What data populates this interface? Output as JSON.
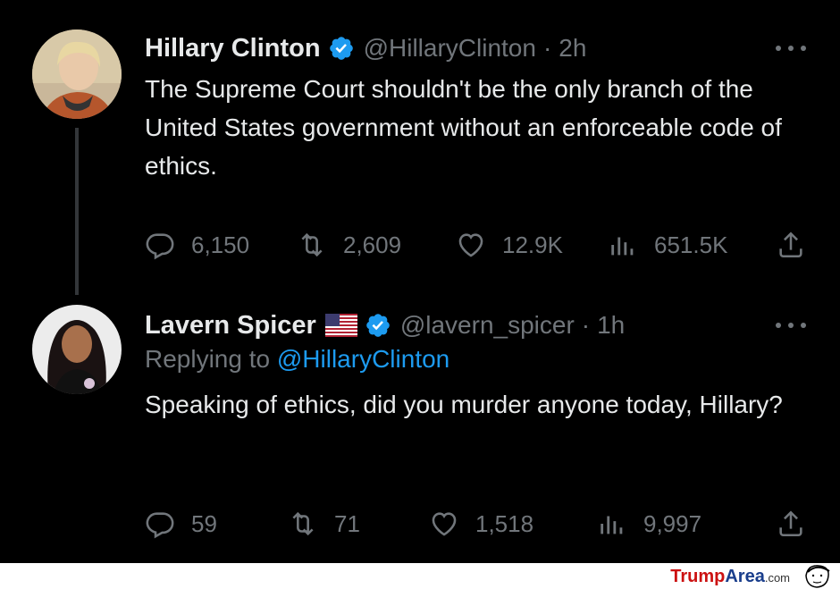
{
  "tweets": [
    {
      "name": "Hillary Clinton",
      "handle": "@HillaryClinton",
      "separator": "·",
      "time": "2h",
      "text": "The Supreme Court shouldn't be the only branch of the United States government without an enforceable code of ethics.",
      "replies": "6,150",
      "retweets": "2,609",
      "likes": "12.9K",
      "views": "651.5K"
    },
    {
      "name": "Lavern Spicer",
      "handle": "@lavern_spicer",
      "separator": "·",
      "time": "1h",
      "replying_label": "Replying to",
      "replying_to": "@HillaryClinton",
      "text": "Speaking of ethics, did you murder anyone today, Hillary?",
      "replies": "59",
      "retweets": "71",
      "likes": "1,518",
      "views": "9,997"
    }
  ],
  "icons": {
    "verified": "verified-badge-icon",
    "flag": "us-flag-icon",
    "reply": "reply-icon",
    "retweet": "retweet-icon",
    "like": "heart-icon",
    "views": "views-icon",
    "share": "share-icon",
    "more": "more-icon"
  },
  "colors": {
    "background": "#000000",
    "text": "#e7e9ea",
    "muted": "#71767b",
    "accent": "#1d9bf0"
  },
  "watermark": {
    "part1": "Trump",
    "part2": "Area",
    "part3": ".com"
  }
}
